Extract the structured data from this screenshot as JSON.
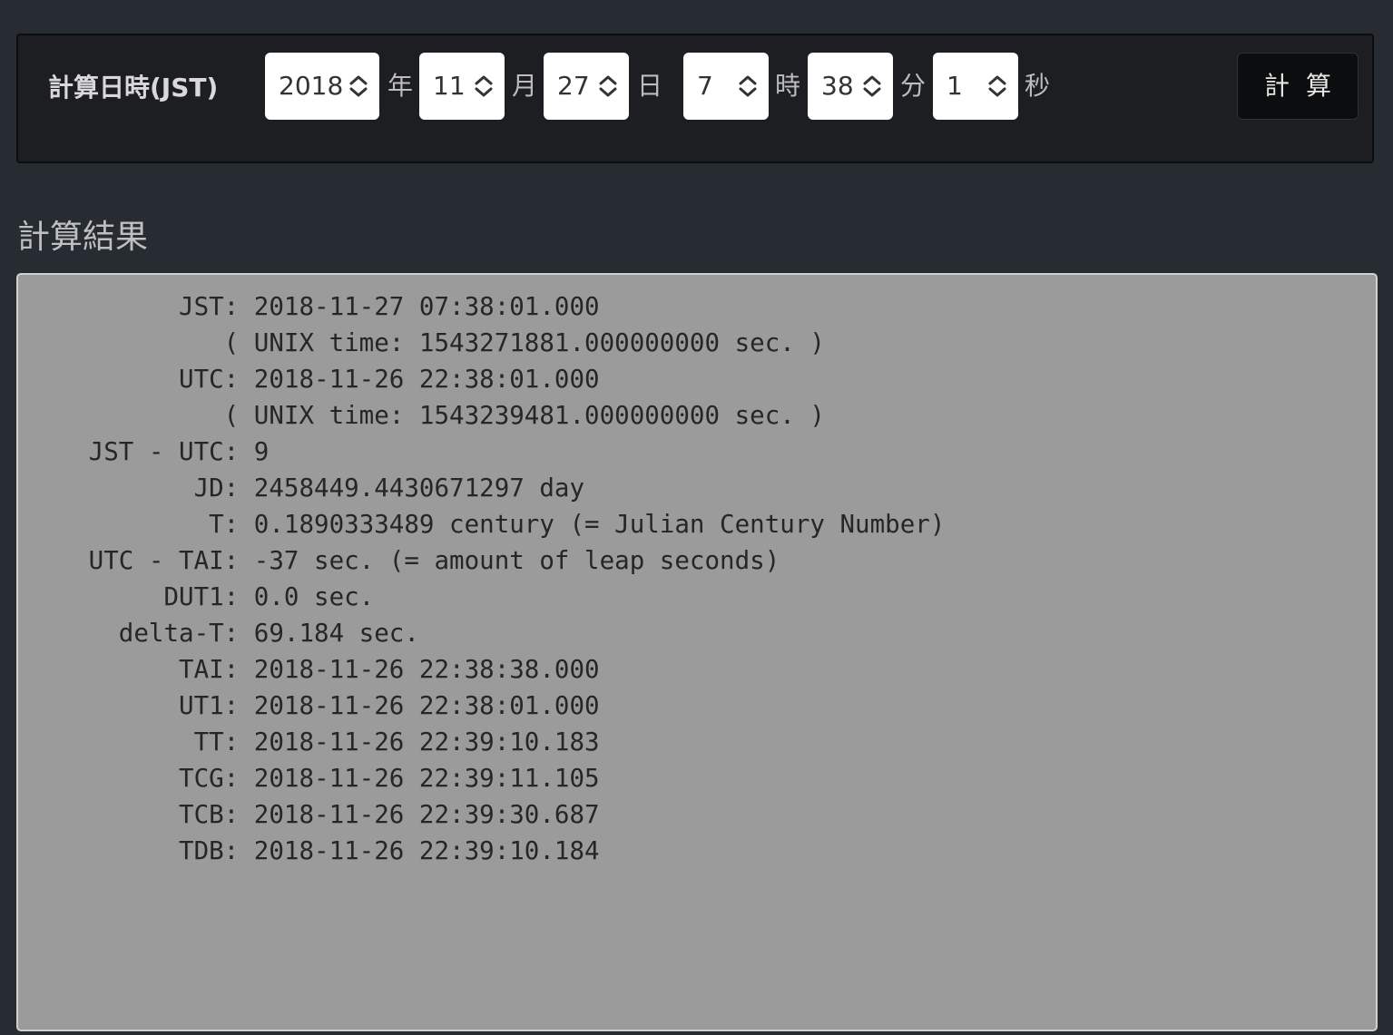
{
  "form": {
    "label": "計算日時(JST)",
    "year": {
      "value": "2018",
      "unit": "年"
    },
    "month": {
      "value": "11",
      "unit": "月"
    },
    "day": {
      "value": "27",
      "unit": "日"
    },
    "hour": {
      "value": "7",
      "unit": "時"
    },
    "minute": {
      "value": "38",
      "unit": "分"
    },
    "second": {
      "value": "1",
      "unit": "秒"
    },
    "calc_button_label": "計算"
  },
  "result": {
    "heading": "計算結果",
    "lines": [
      "         JST: 2018-11-27 07:38:01.000",
      "            ( UNIX time: 1543271881.000000000 sec. )",
      "         UTC: 2018-11-26 22:38:01.000",
      "            ( UNIX time: 1543239481.000000000 sec. )",
      "   JST - UTC: 9",
      "          JD: 2458449.4430671297 day",
      "           T: 0.1890333489 century (= Julian Century Number)",
      "   UTC - TAI: -37 sec. (= amount of leap seconds)",
      "        DUT1: 0.0 sec.",
      "     delta-T: 69.184 sec.",
      "         TAI: 2018-11-26 22:38:38.000",
      "         UT1: 2018-11-26 22:38:01.000",
      "          TT: 2018-11-26 22:39:10.183",
      "         TCG: 2018-11-26 22:39:11.105",
      "         TCB: 2018-11-26 22:39:30.687",
      "         TDB: 2018-11-26 22:39:10.184"
    ]
  },
  "colors": {
    "background": "#272b32",
    "panel": "#1c1e22",
    "result_box": "#9b9b9b",
    "button": "#0c0d0e"
  },
  "icons": {
    "select_indicator": "chevron-up-down-icon"
  }
}
